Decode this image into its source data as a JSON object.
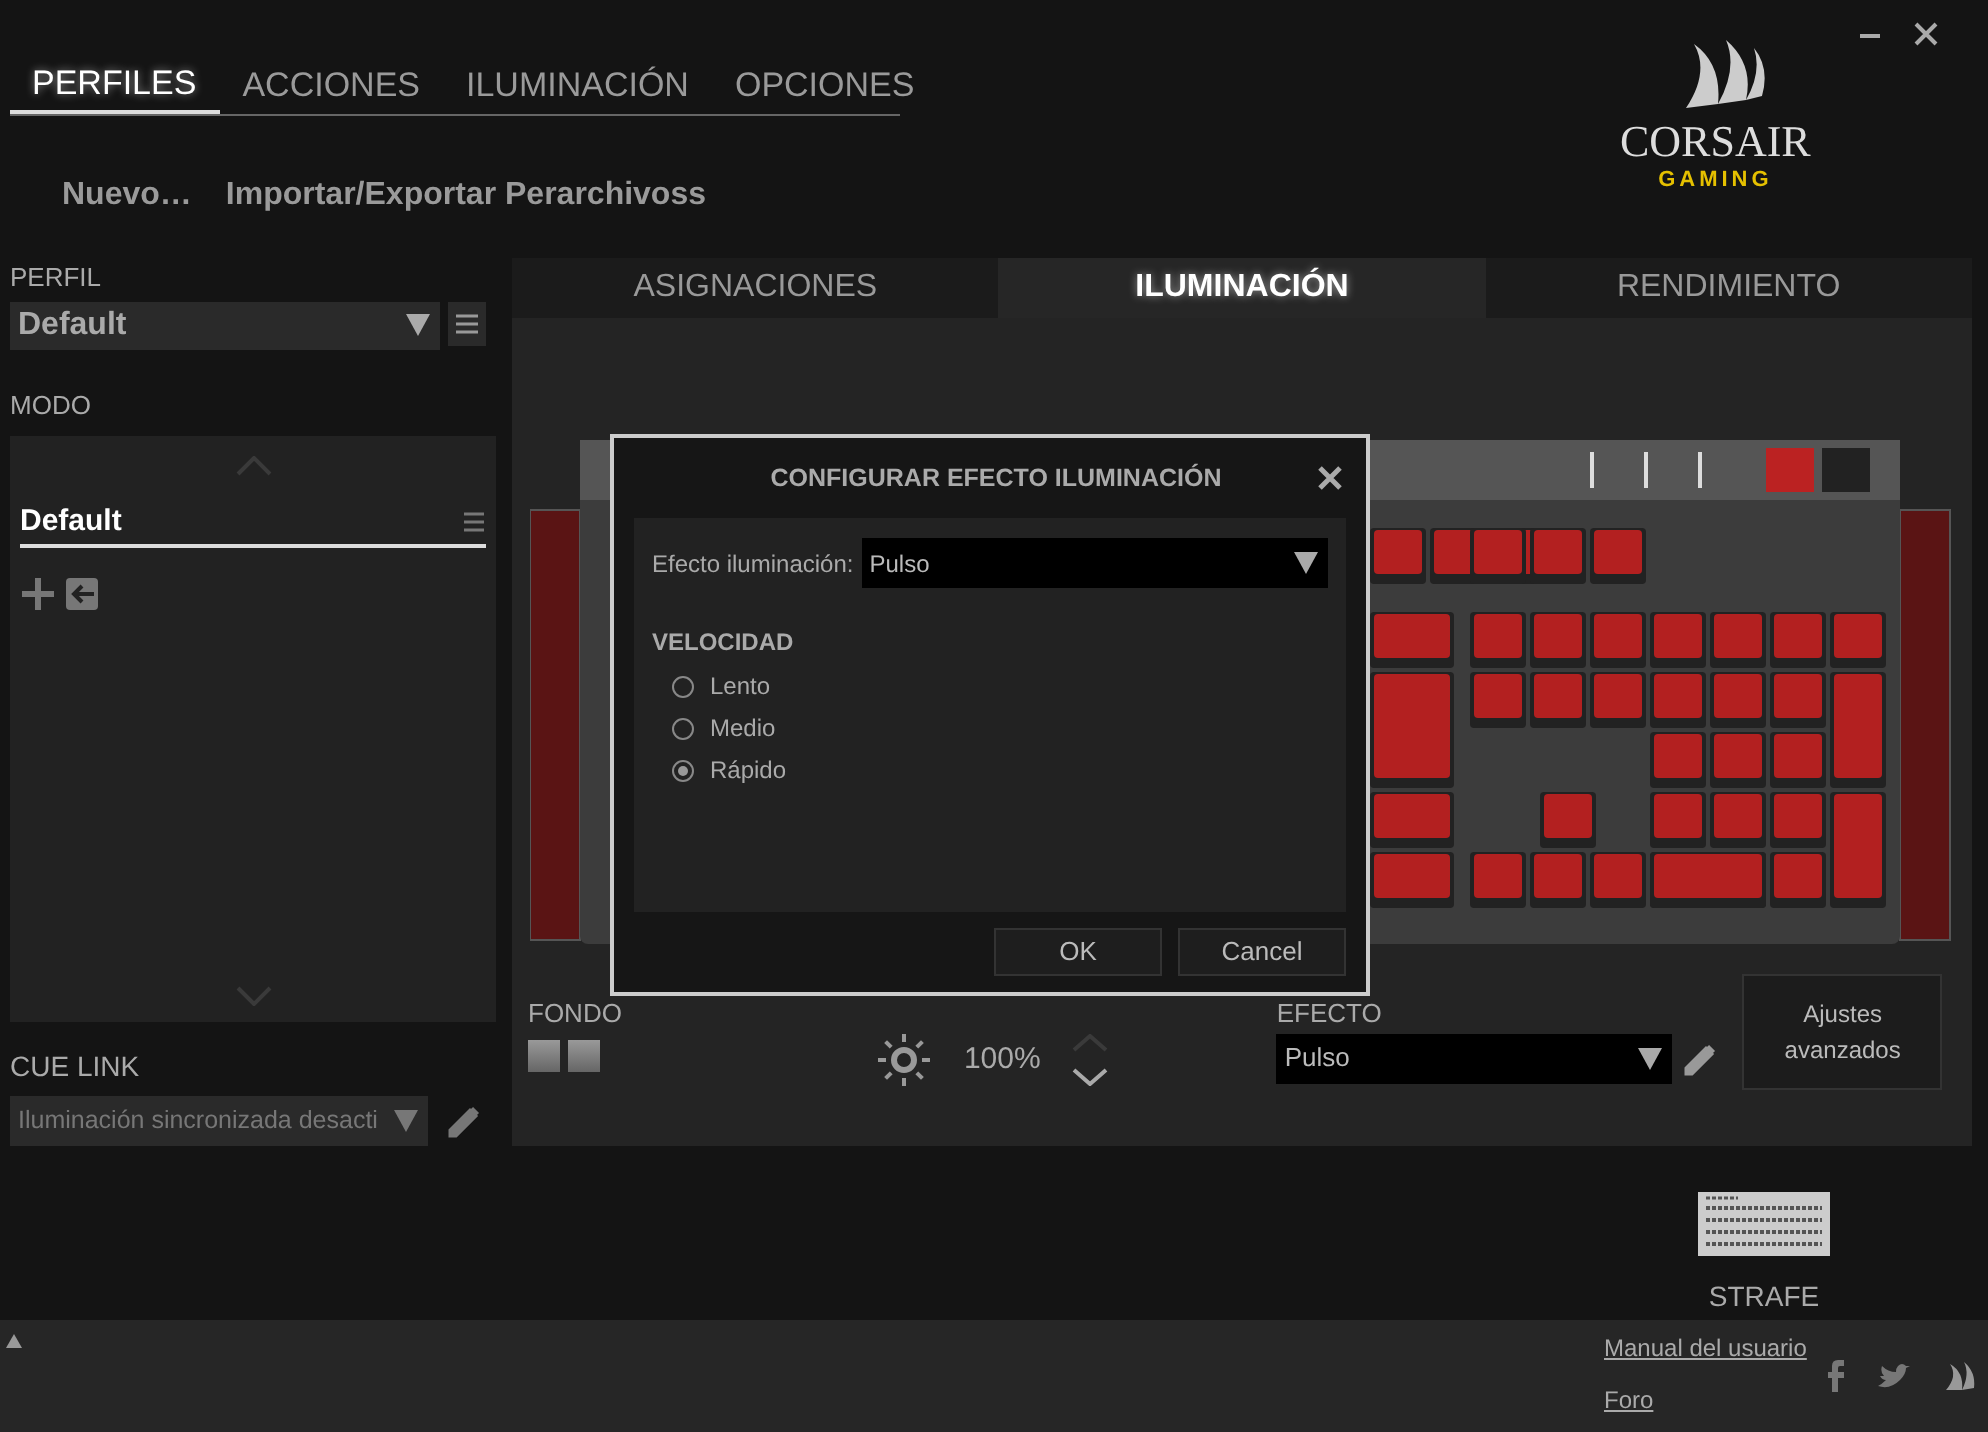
{
  "nav_tabs": [
    {
      "label": "PERFILES",
      "selected": true
    },
    {
      "label": "ACCIONES",
      "selected": false
    },
    {
      "label": "ILUMINACIÓN",
      "selected": false
    },
    {
      "label": "OPCIONES",
      "selected": false
    }
  ],
  "profile_actions": [
    "Nuevo…",
    "Importar/Exportar Perarchivoss"
  ],
  "logo": {
    "brand": "CORSAIR",
    "sub": "GAMING"
  },
  "perfil": {
    "label": "PERFIL",
    "value": "Default"
  },
  "modo": {
    "label": "MODO",
    "items": [
      {
        "label": "Default",
        "selected": true
      }
    ]
  },
  "cue_link": {
    "label": "CUE LINK",
    "value": "Iluminación sincronizada desacti"
  },
  "panel_tabs": [
    {
      "label": "ASIGNACIONES",
      "selected": false
    },
    {
      "label": "ILUMINACIÓN",
      "selected": true
    },
    {
      "label": "RENDIMIENTO",
      "selected": false
    }
  ],
  "fondo": {
    "label": "FONDO"
  },
  "brightness": {
    "reading": "100%"
  },
  "efecto": {
    "label": "EFECTO",
    "value": "Pulso"
  },
  "advanced_button": "Ajustes avanzados",
  "dialog": {
    "title": "CONFIGURAR EFECTO ILUMINACIÓN",
    "effect_label": "Efecto iluminación:",
    "effect_value": "Pulso",
    "speed_label": "VELOCIDAD",
    "speeds": [
      {
        "label": "Lento",
        "selected": false
      },
      {
        "label": "Medio",
        "selected": false
      },
      {
        "label": "Rápido",
        "selected": true
      }
    ],
    "buttons": [
      "OK",
      "Cancel"
    ]
  },
  "device": {
    "name": "STRAFE"
  },
  "footer": {
    "links": [
      "Manual del usuario",
      "Foro"
    ]
  }
}
